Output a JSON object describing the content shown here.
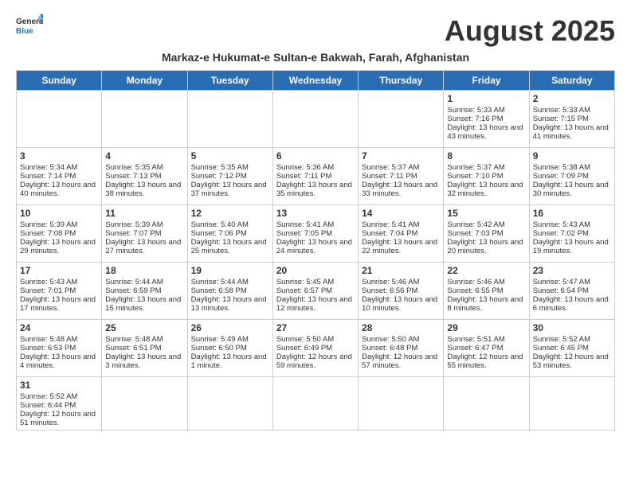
{
  "logo": {
    "general": "General",
    "blue": "Blue"
  },
  "title": "August 2025",
  "subtitle": "Markaz-e Hukumat-e Sultan-e Bakwah, Farah, Afghanistan",
  "weekdays": [
    "Sunday",
    "Monday",
    "Tuesday",
    "Wednesday",
    "Thursday",
    "Friday",
    "Saturday"
  ],
  "weeks": [
    [
      {
        "day": "",
        "info": ""
      },
      {
        "day": "",
        "info": ""
      },
      {
        "day": "",
        "info": ""
      },
      {
        "day": "",
        "info": ""
      },
      {
        "day": "",
        "info": ""
      },
      {
        "day": "1",
        "info": "Sunrise: 5:33 AM\nSunset: 7:16 PM\nDaylight: 13 hours and 43 minutes."
      },
      {
        "day": "2",
        "info": "Sunrise: 5:33 AM\nSunset: 7:15 PM\nDaylight: 13 hours and 41 minutes."
      }
    ],
    [
      {
        "day": "3",
        "info": "Sunrise: 5:34 AM\nSunset: 7:14 PM\nDaylight: 13 hours and 40 minutes."
      },
      {
        "day": "4",
        "info": "Sunrise: 5:35 AM\nSunset: 7:13 PM\nDaylight: 13 hours and 38 minutes."
      },
      {
        "day": "5",
        "info": "Sunrise: 5:35 AM\nSunset: 7:12 PM\nDaylight: 13 hours and 37 minutes."
      },
      {
        "day": "6",
        "info": "Sunrise: 5:36 AM\nSunset: 7:11 PM\nDaylight: 13 hours and 35 minutes."
      },
      {
        "day": "7",
        "info": "Sunrise: 5:37 AM\nSunset: 7:11 PM\nDaylight: 13 hours and 33 minutes."
      },
      {
        "day": "8",
        "info": "Sunrise: 5:37 AM\nSunset: 7:10 PM\nDaylight: 13 hours and 32 minutes."
      },
      {
        "day": "9",
        "info": "Sunrise: 5:38 AM\nSunset: 7:09 PM\nDaylight: 13 hours and 30 minutes."
      }
    ],
    [
      {
        "day": "10",
        "info": "Sunrise: 5:39 AM\nSunset: 7:08 PM\nDaylight: 13 hours and 29 minutes."
      },
      {
        "day": "11",
        "info": "Sunrise: 5:39 AM\nSunset: 7:07 PM\nDaylight: 13 hours and 27 minutes."
      },
      {
        "day": "12",
        "info": "Sunrise: 5:40 AM\nSunset: 7:06 PM\nDaylight: 13 hours and 25 minutes."
      },
      {
        "day": "13",
        "info": "Sunrise: 5:41 AM\nSunset: 7:05 PM\nDaylight: 13 hours and 24 minutes."
      },
      {
        "day": "14",
        "info": "Sunrise: 5:41 AM\nSunset: 7:04 PM\nDaylight: 13 hours and 22 minutes."
      },
      {
        "day": "15",
        "info": "Sunrise: 5:42 AM\nSunset: 7:03 PM\nDaylight: 13 hours and 20 minutes."
      },
      {
        "day": "16",
        "info": "Sunrise: 5:43 AM\nSunset: 7:02 PM\nDaylight: 13 hours and 19 minutes."
      }
    ],
    [
      {
        "day": "17",
        "info": "Sunrise: 5:43 AM\nSunset: 7:01 PM\nDaylight: 13 hours and 17 minutes."
      },
      {
        "day": "18",
        "info": "Sunrise: 5:44 AM\nSunset: 6:59 PM\nDaylight: 13 hours and 15 minutes."
      },
      {
        "day": "19",
        "info": "Sunrise: 5:44 AM\nSunset: 6:58 PM\nDaylight: 13 hours and 13 minutes."
      },
      {
        "day": "20",
        "info": "Sunrise: 5:45 AM\nSunset: 6:57 PM\nDaylight: 13 hours and 12 minutes."
      },
      {
        "day": "21",
        "info": "Sunrise: 5:46 AM\nSunset: 6:56 PM\nDaylight: 13 hours and 10 minutes."
      },
      {
        "day": "22",
        "info": "Sunrise: 5:46 AM\nSunset: 6:55 PM\nDaylight: 13 hours and 8 minutes."
      },
      {
        "day": "23",
        "info": "Sunrise: 5:47 AM\nSunset: 6:54 PM\nDaylight: 13 hours and 6 minutes."
      }
    ],
    [
      {
        "day": "24",
        "info": "Sunrise: 5:48 AM\nSunset: 6:53 PM\nDaylight: 13 hours and 4 minutes."
      },
      {
        "day": "25",
        "info": "Sunrise: 5:48 AM\nSunset: 6:51 PM\nDaylight: 13 hours and 3 minutes."
      },
      {
        "day": "26",
        "info": "Sunrise: 5:49 AM\nSunset: 6:50 PM\nDaylight: 13 hours and 1 minute."
      },
      {
        "day": "27",
        "info": "Sunrise: 5:50 AM\nSunset: 6:49 PM\nDaylight: 12 hours and 59 minutes."
      },
      {
        "day": "28",
        "info": "Sunrise: 5:50 AM\nSunset: 6:48 PM\nDaylight: 12 hours and 57 minutes."
      },
      {
        "day": "29",
        "info": "Sunrise: 5:51 AM\nSunset: 6:47 PM\nDaylight: 12 hours and 55 minutes."
      },
      {
        "day": "30",
        "info": "Sunrise: 5:52 AM\nSunset: 6:45 PM\nDaylight: 12 hours and 53 minutes."
      }
    ],
    [
      {
        "day": "31",
        "info": "Sunrise: 5:52 AM\nSunset: 6:44 PM\nDaylight: 12 hours and 51 minutes."
      },
      {
        "day": "",
        "info": ""
      },
      {
        "day": "",
        "info": ""
      },
      {
        "day": "",
        "info": ""
      },
      {
        "day": "",
        "info": ""
      },
      {
        "day": "",
        "info": ""
      },
      {
        "day": "",
        "info": ""
      }
    ]
  ]
}
